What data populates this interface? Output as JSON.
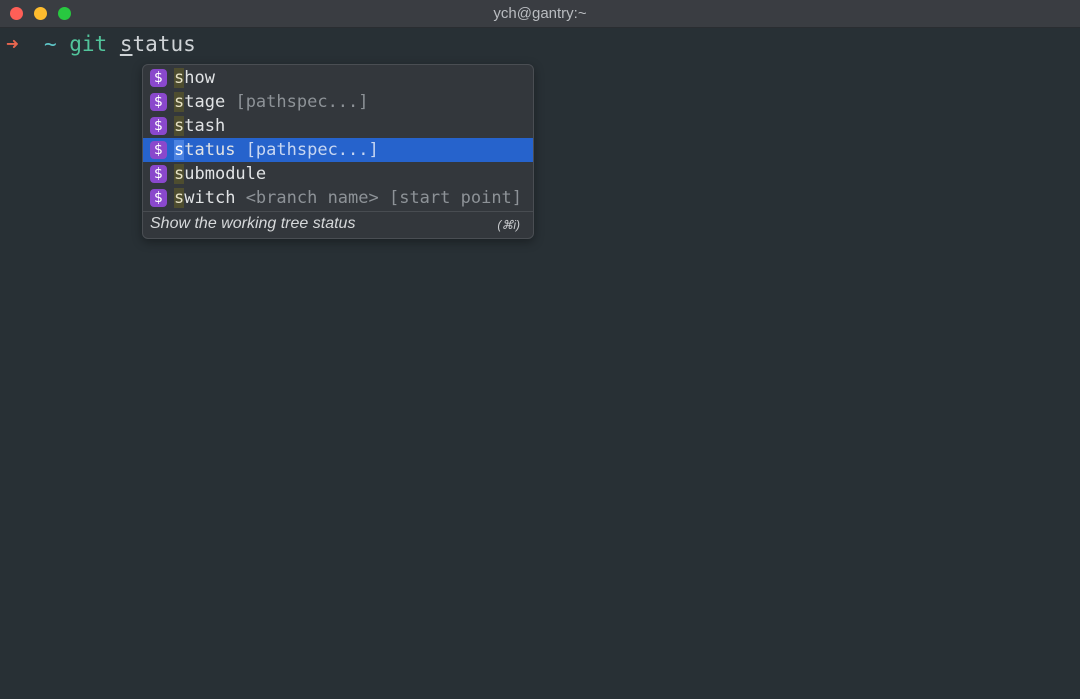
{
  "window": {
    "title": "ych@gantry:~"
  },
  "prompt": {
    "arrow": "➜",
    "cwd": "~",
    "command": "git",
    "typed_prefix": "s",
    "typed_rest": "tatus"
  },
  "completion": {
    "items": [
      {
        "match": "s",
        "rest": "how",
        "args": ""
      },
      {
        "match": "s",
        "rest": "tage",
        "args": "[pathspec...]"
      },
      {
        "match": "s",
        "rest": "tash",
        "args": ""
      },
      {
        "match": "s",
        "rest": "tatus",
        "args": "[pathspec...]"
      },
      {
        "match": "s",
        "rest": "ubmodule",
        "args": ""
      },
      {
        "match": "s",
        "rest": "witch",
        "args": "<branch name> [start point]"
      }
    ],
    "selected_index": 3,
    "badge": "$",
    "description": "Show the working tree status",
    "shortcut": "(⌘i)"
  },
  "colors": {
    "background": "#283035",
    "selection": "#2663cc",
    "badge": "#8a48cc",
    "prompt_arrow": "#e8664f",
    "prompt_cwd": "#5ec4c6",
    "command": "#52c49b"
  }
}
